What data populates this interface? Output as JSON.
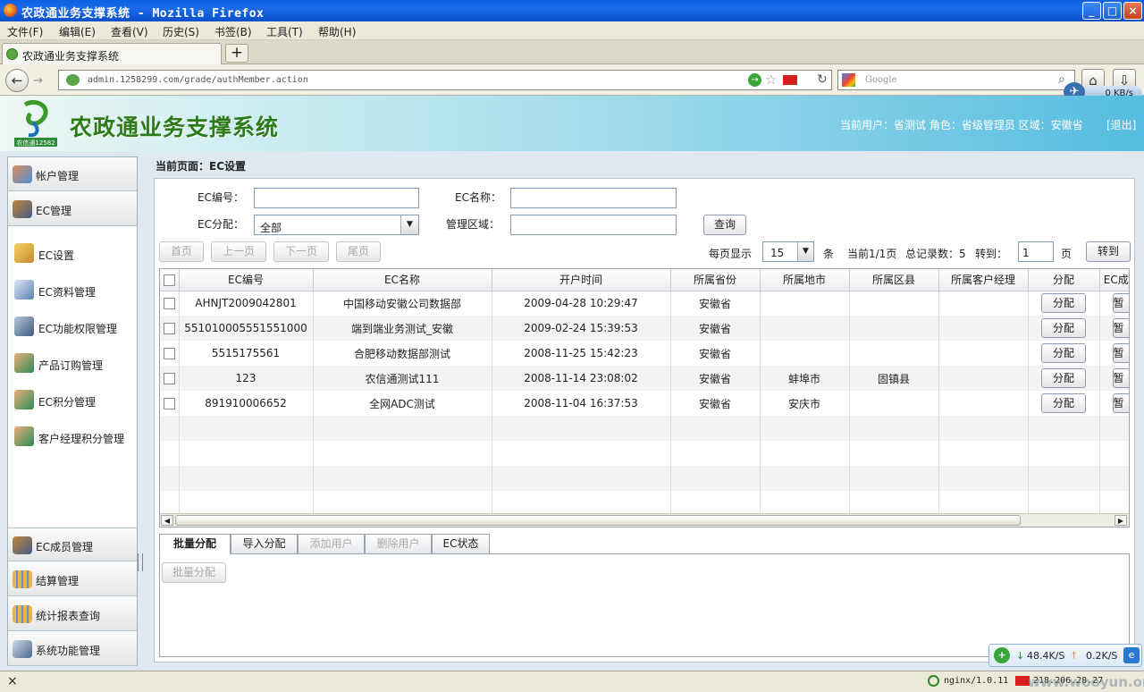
{
  "window": {
    "title": "农政通业务支撑系统 - Mozilla Firefox"
  },
  "menu": [
    "文件(F)",
    "编辑(E)",
    "查看(V)",
    "历史(S)",
    "书签(B)",
    "工具(T)",
    "帮助(H)"
  ],
  "tab": {
    "label": "农政通业务支撑系统",
    "new_tab": "+"
  },
  "nav": {
    "url": "admin.1258299.com/grade/authMember.action",
    "search_placeholder": "Google",
    "speed": "0 KB/s"
  },
  "app": {
    "title": "农政通业务支撑系统",
    "logo_text": "农信通12582",
    "user_info": "当前用户：省测试  角色：省级管理员 区域：安徽省",
    "logout": "[退出]"
  },
  "sidebar": {
    "groups_top": [
      {
        "label": "帐户管理",
        "icon": "users-icon"
      },
      {
        "label": "EC管理",
        "icon": "ec-icon"
      }
    ],
    "items": [
      {
        "label": "EC设置",
        "icon": "edit-icon"
      },
      {
        "label": "EC资料管理",
        "icon": "docs-icon"
      },
      {
        "label": "EC功能权限管理",
        "icon": "permission-icon"
      },
      {
        "label": "产品订购管理",
        "icon": "user-icon"
      },
      {
        "label": "EC积分管理",
        "icon": "user-icon"
      },
      {
        "label": "客户经理积分管理",
        "icon": "user-icon"
      }
    ],
    "groups_bottom": [
      {
        "label": "EC成员管理",
        "icon": "ec-icon"
      },
      {
        "label": "结算管理",
        "icon": "grid-icon"
      },
      {
        "label": "统计报表查询",
        "icon": "grid-icon"
      },
      {
        "label": "系统功能管理",
        "icon": "system-icon"
      }
    ]
  },
  "page": {
    "breadcrumb": "当前页面：EC设置",
    "form": {
      "ec_no_label": "EC编号：",
      "ec_name_label": "EC名称：",
      "ec_assign_label": "EC分配：",
      "ec_assign_value": "全部",
      "area_label": "管理区域：",
      "query_button": "查询"
    },
    "pager": {
      "first": "首页",
      "prev": "上一页",
      "next": "下一页",
      "last": "尾页",
      "per_page_label": "每页显示",
      "per_page_value": "15",
      "per_page_unit": "条",
      "page_info": "当前1/1页",
      "total_label": "总记录数：5",
      "goto_label": "转到：",
      "goto_value": "1",
      "page_unit": "页",
      "goto_button": "转到"
    },
    "table": {
      "headers": [
        "EC编号",
        "EC名称",
        "开户时间",
        "所属省份",
        "所属地市",
        "所属区县",
        "所属客户经理",
        "分配",
        "EC成..."
      ],
      "rows": [
        {
          "ec_no": "AHNJT2009042801",
          "name": "中国移动安徽公司数据部",
          "time": "2009-04-28 10:29:47",
          "province": "安徽省",
          "city": "",
          "county": "",
          "manager": "",
          "assign": "分配",
          "status": "暂"
        },
        {
          "ec_no": "551010005551551000",
          "name": "端到端业务测试_安徽",
          "time": "2009-02-24 15:39:53",
          "province": "安徽省",
          "city": "",
          "county": "",
          "manager": "",
          "assign": "分配",
          "status": "暂"
        },
        {
          "ec_no": "5515175561",
          "name": "合肥移动数据部测试",
          "time": "2008-11-25 15:42:23",
          "province": "安徽省",
          "city": "",
          "county": "",
          "manager": "",
          "assign": "分配",
          "status": "暂"
        },
        {
          "ec_no": "123",
          "name": "农信通测试111",
          "time": "2008-11-14 23:08:02",
          "province": "安徽省",
          "city": "蚌埠市",
          "county": "固镇县",
          "manager": "",
          "assign": "分配",
          "status": "暂"
        },
        {
          "ec_no": "891910006652",
          "name": "全网ADC测试",
          "time": "2008-11-04 16:37:53",
          "province": "安徽省",
          "city": "安庆市",
          "county": "",
          "manager": "",
          "assign": "分配",
          "status": "暂"
        }
      ]
    },
    "bottom_tabs": [
      "批量分配",
      "导入分配",
      "添加用户",
      "删除用户",
      "EC状态"
    ],
    "batch_button": "批量分配"
  },
  "status": {
    "close": "×",
    "server": "nginx/1.0.11",
    "ip": "218.206.28.27",
    "down": "48.4K/S",
    "up": "0.2K/S",
    "watermark": "www.wooyun.org"
  }
}
